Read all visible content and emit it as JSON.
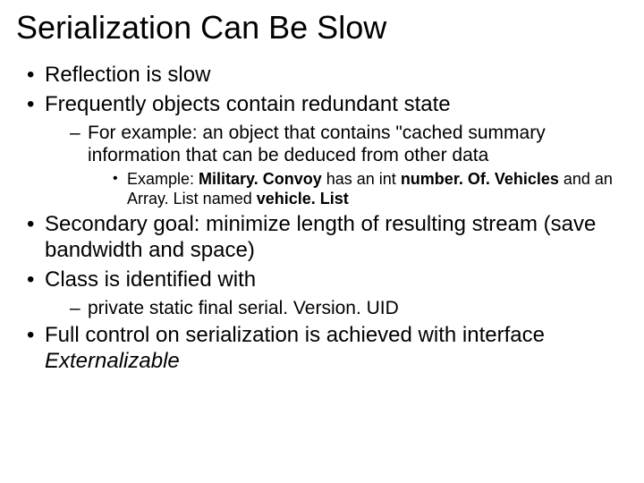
{
  "title": "Serialization Can Be Slow",
  "bullets": {
    "b1": "Reflection is slow",
    "b2": "Frequently objects contain redundant state",
    "b2_1_a": "For example: an object that contains \"cached summary information that can be deduced from other data",
    "b2_1_1_pre": "Example: ",
    "b2_1_1_bold1": "Military. Convoy",
    "b2_1_1_mid1": " has an int ",
    "b2_1_1_bold2": "number. Of. Vehicles",
    "b2_1_1_mid2": " and an Array. List named ",
    "b2_1_1_bold3": "vehicle. List",
    "b3": "Secondary goal: minimize length of resulting stream (save bandwidth and space)",
    "b4": "Class is identified with",
    "b4_1": "private static final serial. Version. UID",
    "b5_a": "Full control on serialization is achieved with interface ",
    "b5_i": "Externalizable"
  }
}
